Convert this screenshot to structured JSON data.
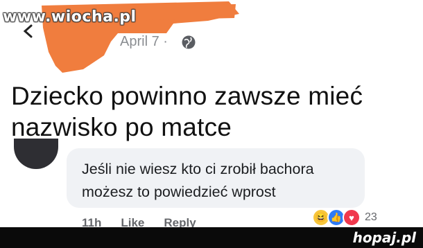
{
  "watermark": "www.wiocha.pl",
  "post": {
    "date": "April 7 ·",
    "text": "Dziecko powinno zawsze mieć nazwisko po matce"
  },
  "comment": {
    "text_line1": "Jeśli nie wiesz kto ci zrobił bachora",
    "text_line2": "możesz to powiedzieć wprost",
    "time": "11h",
    "like_label": "Like",
    "reply_label": "Reply",
    "reaction_count": "23",
    "reaction_icons": [
      "haha-icon",
      "like-icon",
      "love-icon"
    ]
  },
  "footer": {
    "logo": "hopaj.pl"
  },
  "colors": {
    "redaction": "#f07d3e",
    "bubble": "#f0f2f5",
    "footer": "#0a0a0a"
  }
}
